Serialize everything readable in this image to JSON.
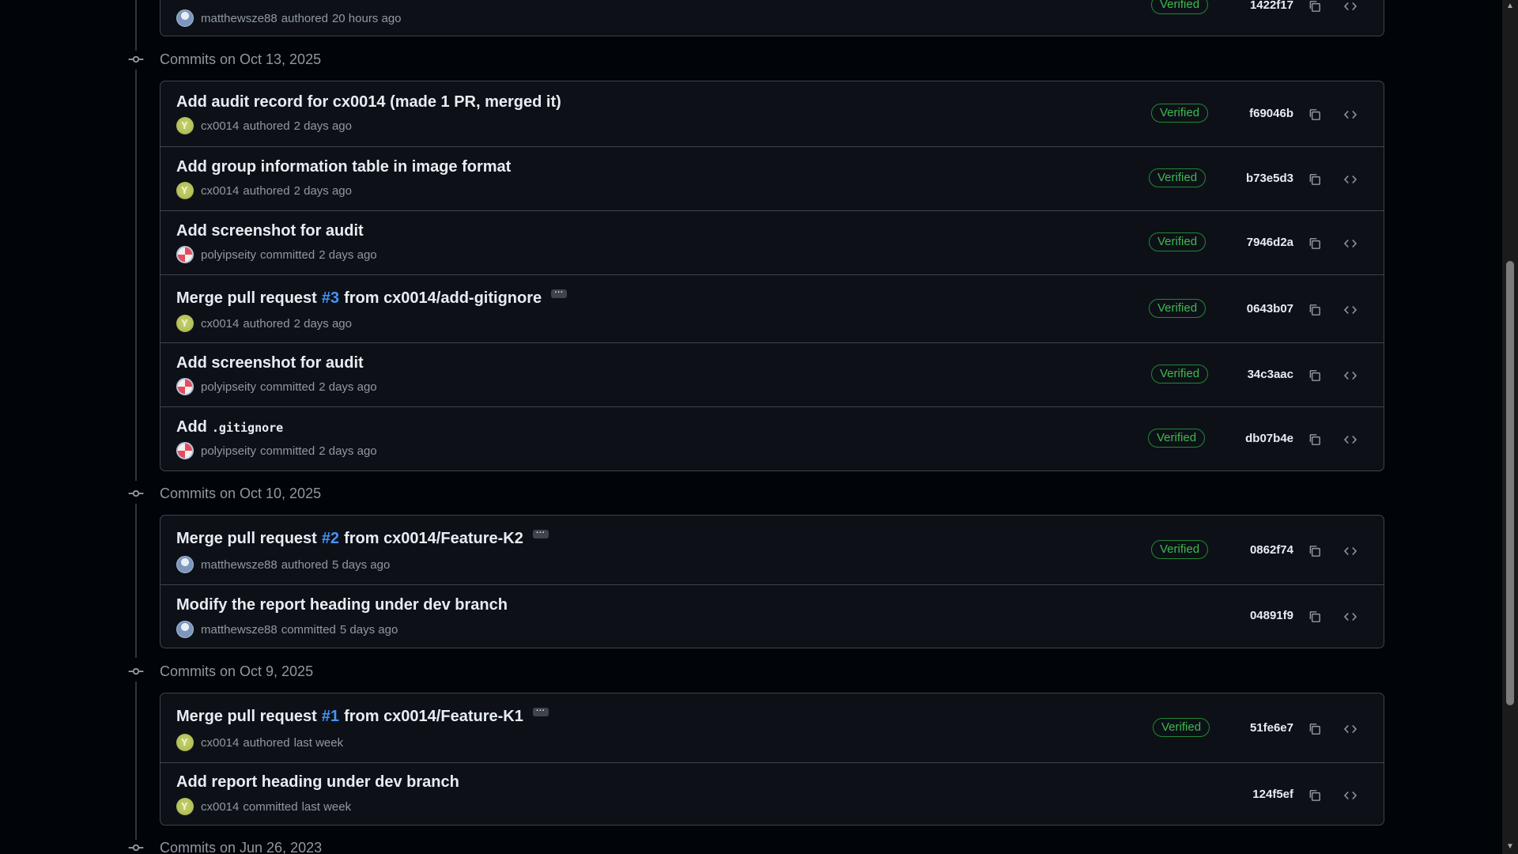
{
  "top_partial_row": {
    "author": "matthewsze88",
    "action": "authored",
    "time": "20 hours ago",
    "verified": "Verified",
    "sha": "1422f17"
  },
  "groups": [
    {
      "date_label": "Commits on Oct 13, 2025",
      "commits": [
        {
          "title": "Add audit record for cx0014 (made 1 PR, merged it)",
          "author": "cx0014",
          "action": "authored",
          "time": "2 days ago",
          "verified": "Verified",
          "sha": "f69046b"
        },
        {
          "title": "Add group information table in image format",
          "author": "cx0014",
          "action": "authored",
          "time": "2 days ago",
          "verified": "Verified",
          "sha": "b73e5d3"
        },
        {
          "title": "Add screenshot for audit",
          "author": "polyipseity",
          "action": "committed",
          "time": "2 days ago",
          "verified": "Verified",
          "sha": "7946d2a"
        },
        {
          "title_prefix": "Merge pull request",
          "pr": "#3",
          "title_suffix": "from cx0014/add-gitignore",
          "author": "cx0014",
          "action": "authored",
          "time": "2 days ago",
          "verified": "Verified",
          "sha": "0643b07"
        },
        {
          "title": "Add screenshot for audit",
          "author": "polyipseity",
          "action": "committed",
          "time": "2 days ago",
          "verified": "Verified",
          "sha": "34c3aac"
        },
        {
          "title_prefix": "Add",
          "code": ".gitignore",
          "author": "polyipseity",
          "action": "committed",
          "time": "2 days ago",
          "verified": "Verified",
          "sha": "db07b4e"
        }
      ]
    },
    {
      "date_label": "Commits on Oct 10, 2025",
      "commits": [
        {
          "title_prefix": "Merge pull request",
          "pr": "#2",
          "title_suffix": "from cx0014/Feature-K2",
          "author": "matthewsze88",
          "action": "authored",
          "time": "5 days ago",
          "verified": "Verified",
          "sha": "0862f74"
        },
        {
          "title": "Modify the report heading under dev branch",
          "author": "matthewsze88",
          "action": "committed",
          "time": "5 days ago",
          "sha": "04891f9"
        }
      ]
    },
    {
      "date_label": "Commits on Oct 9, 2025",
      "commits": [
        {
          "title_prefix": "Merge pull request",
          "pr": "#1",
          "title_suffix": "from cx0014/Feature-K1",
          "author": "cx0014",
          "action": "authored",
          "time": "last week",
          "verified": "Verified",
          "sha": "51fe6e7"
        },
        {
          "title": "Add report heading under dev branch",
          "author": "cx0014",
          "action": "committed",
          "time": "last week",
          "sha": "124f5ef"
        }
      ]
    },
    {
      "date_label": "Commits on Jun 26, 2023"
    }
  ],
  "icons": {
    "copy": "copy-icon",
    "browse": "code-icon",
    "commit": "git-commit-icon",
    "ellipsis": "ellipsis-icon"
  },
  "colors": {
    "background": "#010409",
    "box_bg": "#0d1117",
    "border": "#3d444d",
    "verified": "#3fb950",
    "link": "#4493f8",
    "muted": "#9198a1"
  }
}
